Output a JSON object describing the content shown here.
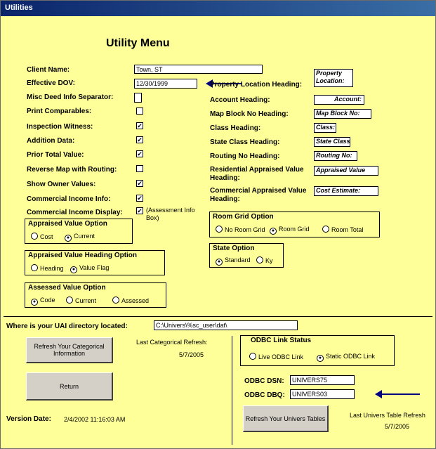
{
  "window": {
    "title": "Utilities"
  },
  "heading": "Utility Menu",
  "fields": {
    "client_name": {
      "label": "Client Name:",
      "value": "Town, ST"
    },
    "effective_date": {
      "label": "Effective DOV:",
      "value": "12/30/1999"
    },
    "misc_separator": {
      "label": "Misc Deed Info Separator:",
      "value": ""
    },
    "print_comparables": {
      "label": "Print Comparables:",
      "checked": false
    },
    "inspection_witness": {
      "label": "Inspection Witness:",
      "checked": true
    },
    "addition_data": {
      "label": "Addition Data:",
      "checked": true
    },
    "prior_total_value": {
      "label": "Prior Total Value:",
      "checked": true
    },
    "reverse_map": {
      "label": "Reverse Map with Routing:",
      "checked": false
    },
    "show_owner_values": {
      "label": "Show Owner Values:",
      "checked": true
    },
    "commercial_income_info": {
      "label": "Commercial Income Info:",
      "checked": true
    },
    "commercial_income_display": {
      "label": "Commercial Income Display:",
      "checked": true,
      "note": "(Assessment Info Box)"
    }
  },
  "headings": {
    "property_location": {
      "label": "Property Location Heading:",
      "value": "Property Location:"
    },
    "account": {
      "label": "Account Heading:",
      "value": "Account:"
    },
    "map_block": {
      "label": "Map Block No Heading:",
      "value": "Map Block No:"
    },
    "class": {
      "label": "Class Heading:",
      "value": "Class:"
    },
    "state_class": {
      "label": "State Class Heading:",
      "value": "State Class"
    },
    "routing": {
      "label": "Routing No Heading:",
      "value": "Routing No:"
    },
    "residential": {
      "label": "Residential Appraised Value Heading:",
      "value": "Appraised Value"
    },
    "commercial": {
      "label": "Commercial Appraised Value Heading:",
      "value": "Cost Estimate:"
    }
  },
  "groups": {
    "appraised_value_option": {
      "title": "Appraised Value Option",
      "options": [
        "Cost",
        "Current"
      ],
      "selected": 1
    },
    "appraised_heading_option": {
      "title": "Appraised Value Heading Option",
      "options": [
        "Heading",
        "Value Flag"
      ],
      "selected": 1
    },
    "assessed_value_option": {
      "title": "Assessed Value Option",
      "options": [
        "Code",
        "Current",
        "Assessed"
      ],
      "selected": 0
    },
    "room_grid_option": {
      "title": "Room Grid Option",
      "options": [
        "No Room Grid",
        "Room Grid",
        "Room Total"
      ],
      "selected": 1
    },
    "state_option": {
      "title": "State Option",
      "options": [
        "Standard",
        "Ky"
      ],
      "selected": 0
    },
    "odbc_link_status": {
      "title": "ODBC Link Status",
      "options": [
        "Live ODBC Link",
        "Static ODBC Link"
      ],
      "selected": 1
    }
  },
  "directory": {
    "label": "Where is your UAI directory located:",
    "value": "C:\\Univers\\%sc_user\\dat\\"
  },
  "buttons": {
    "refresh_categorical": "Refresh Your Categorical Information",
    "return": "Return",
    "refresh_univers": "Refresh Your Univers Tables"
  },
  "refresh_info": {
    "categorical_label": "Last Categorical Refresh:",
    "categorical_date": "5/7/2005",
    "univers_label": "Last Univers Table Refresh",
    "univers_date": "5/7/2005"
  },
  "odbc": {
    "dsn_label": "ODBC DSN:",
    "dsn_value": "UNIVERS75",
    "dbq_label": "ODBC DBQ:",
    "dbq_value": "UNIVERS03"
  },
  "version": {
    "label": "Version Date:",
    "value": "2/4/2002 11:16:03 AM"
  },
  "colors": {
    "form_bg": "#ffff99",
    "titlebar": "#0a246a",
    "arrow": "#000080"
  },
  "icons": {
    "checkmark": "✔",
    "radio_dot": "●",
    "arrow": "left-arrow"
  }
}
